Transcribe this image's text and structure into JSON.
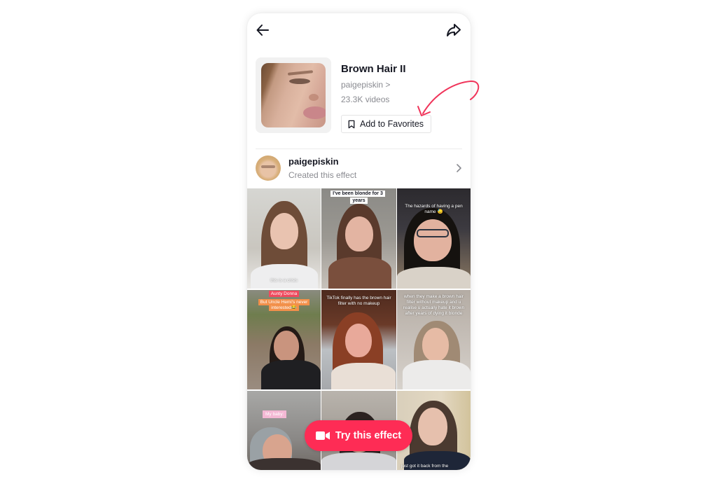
{
  "topbar": {
    "back_icon": "arrow-left-icon",
    "share_icon": "share-arrow-icon"
  },
  "effect": {
    "title": "Brown Hair II",
    "creator_link": "paigepiskin >",
    "video_count": "23.3K videos",
    "favorite_button": {
      "label": "Add to Favorites",
      "icon": "bookmark-icon"
    }
  },
  "creator_row": {
    "name": "paigepiskin",
    "subtitle": "Created this effect",
    "chevron_icon": "chevron-right-icon"
  },
  "videos": [
    {
      "caption": "this is a crisis",
      "caption_style": "plain"
    },
    {
      "caption": "I've been blonde for 3 years",
      "caption_style": "box"
    },
    {
      "caption": "The hazards of having a pen name 😓",
      "caption_style": "plain"
    },
    {
      "caption_top": "Aunty Donna",
      "caption": "But Uncle Hemi's never interested😂",
      "caption_style": "orange"
    },
    {
      "caption": "TikTok finally has the brown hair filter with no makeup",
      "caption_style": "plain"
    },
    {
      "caption": "when they make a brown hair filter without makeup and u realise u actually hate it brown after years of dying it blonde",
      "caption_style": "plain"
    },
    {
      "caption": "My baby:",
      "caption_style": "pink"
    },
    {
      "caption": "",
      "caption_style": "none"
    },
    {
      "caption": "just got it back from the",
      "caption_style": "plain"
    }
  ],
  "cta": {
    "label": "Try this effect",
    "icon": "video-camera-icon",
    "color": "#fe2c55"
  },
  "annotation": {
    "color": "#f0345a",
    "icon": "curved-arrow-icon"
  }
}
